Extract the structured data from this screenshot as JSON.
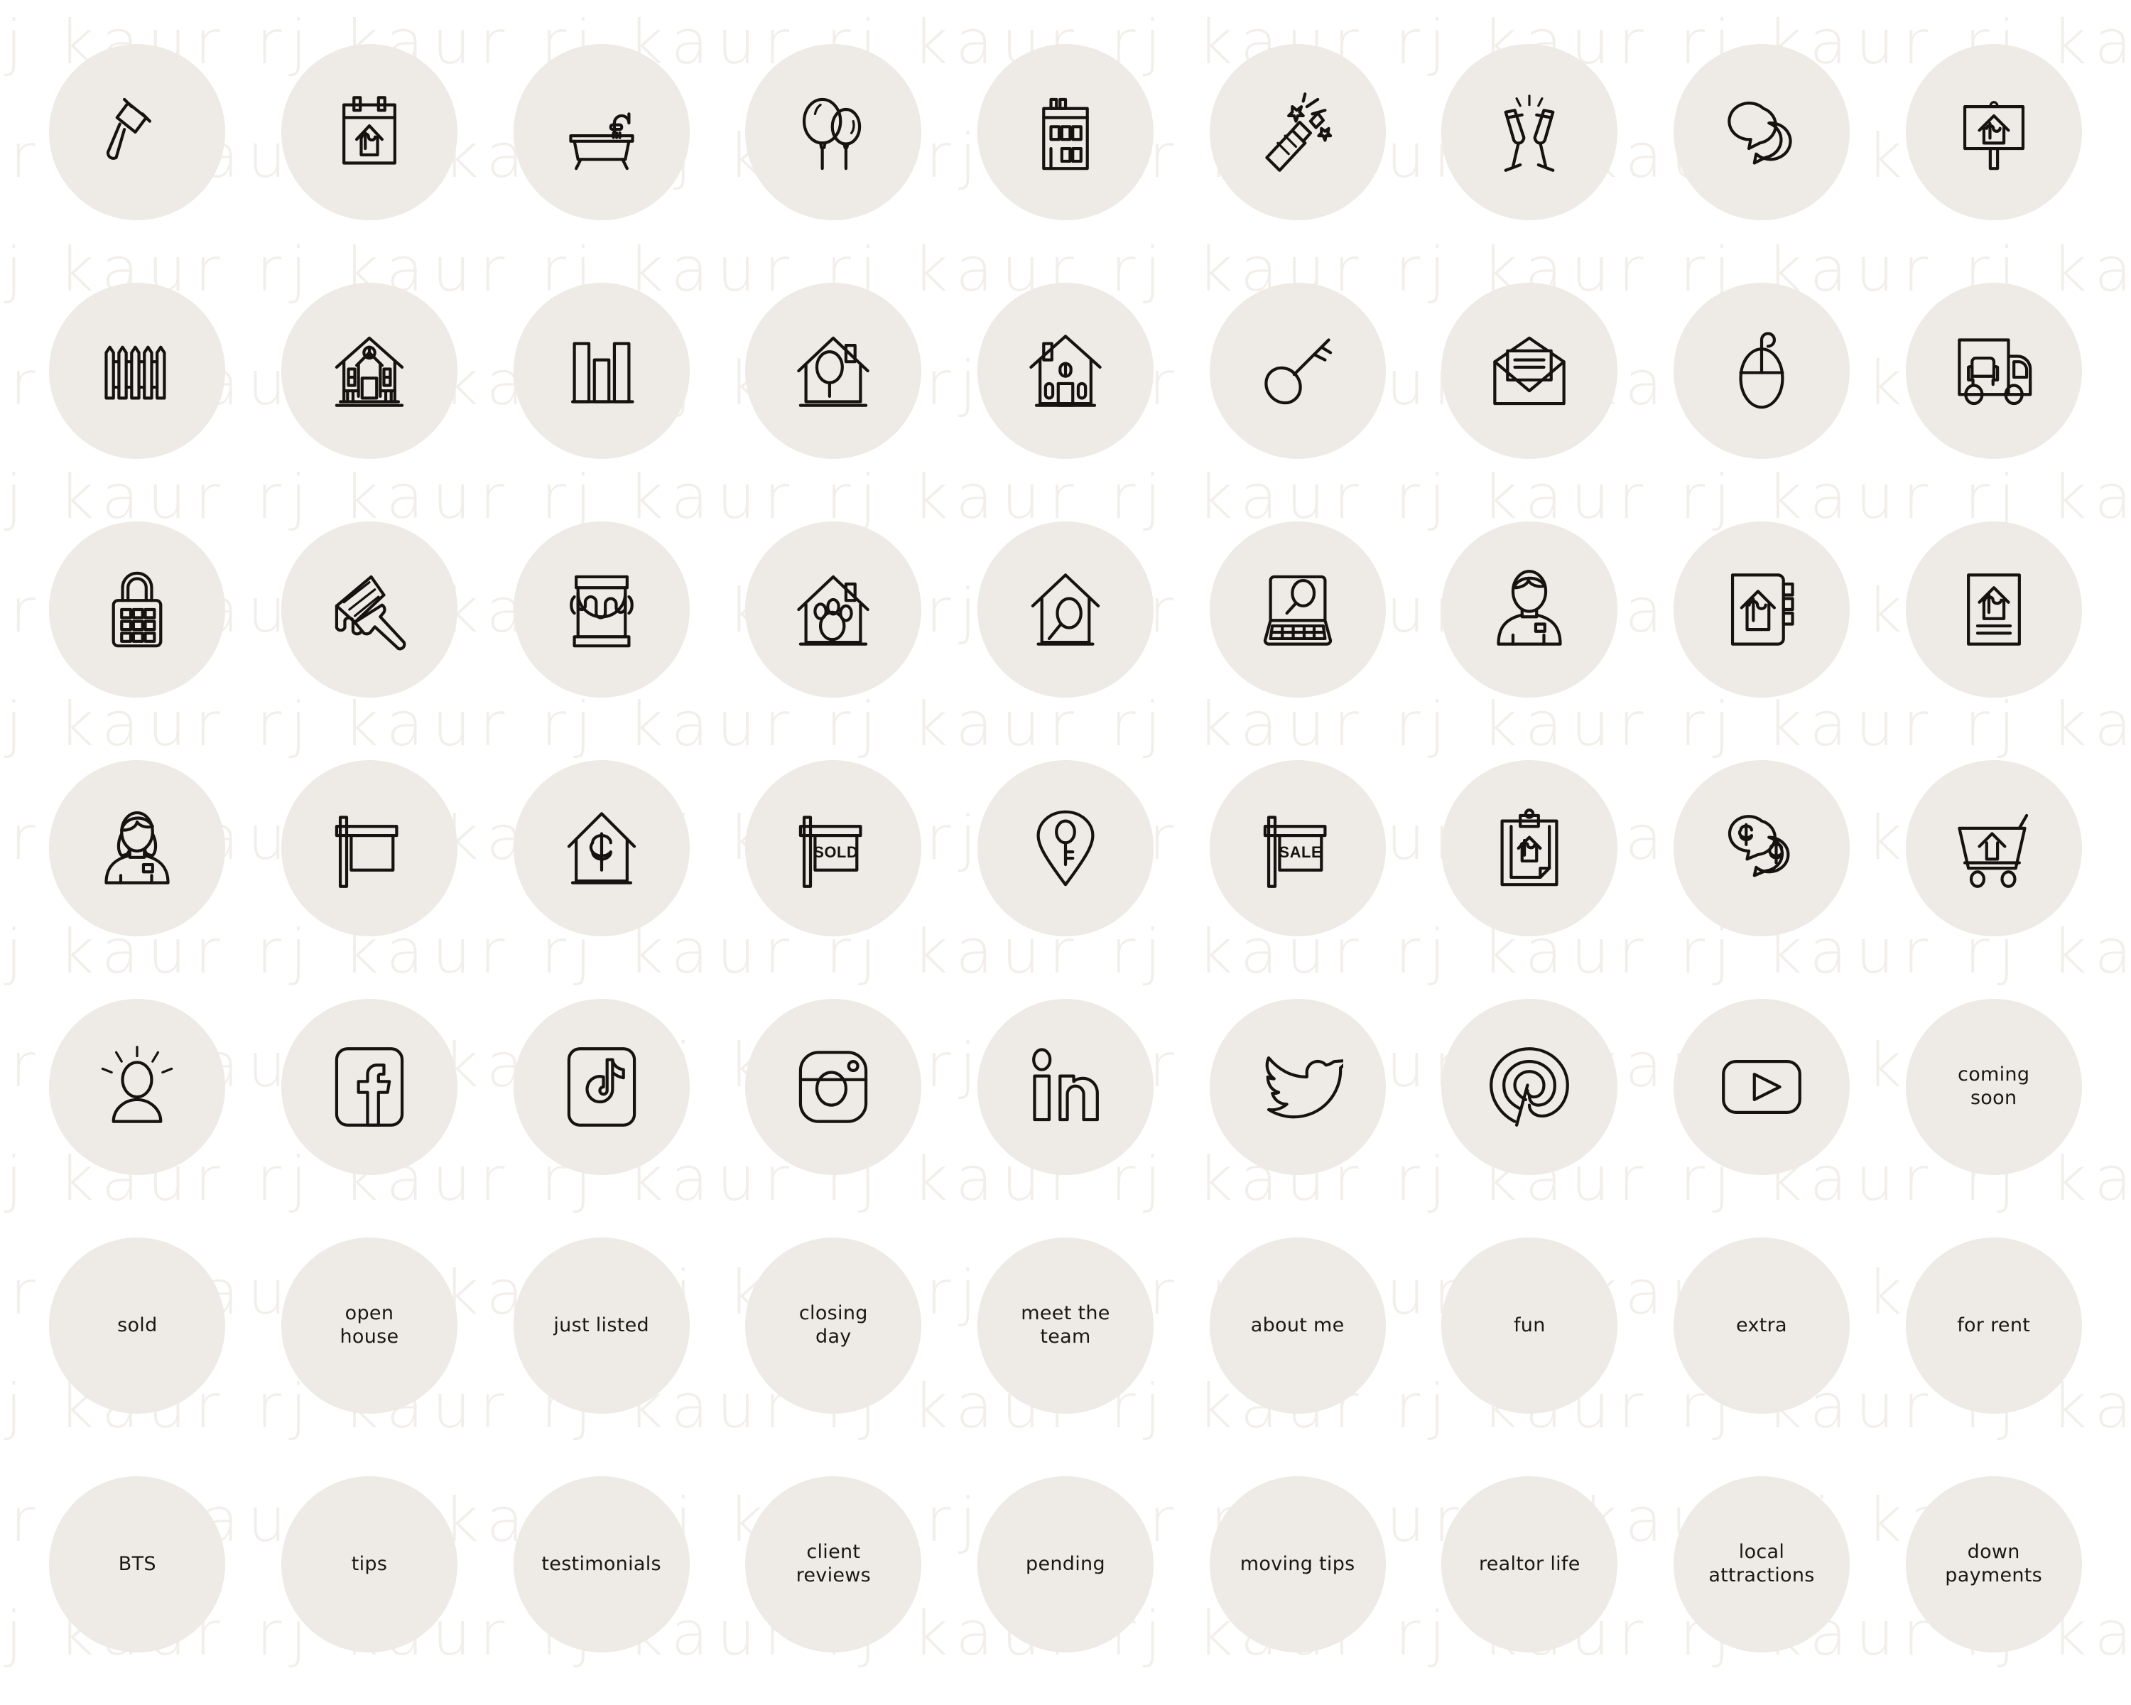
{
  "watermark": {
    "text": "rj kaur rj kaur rj kaur rj kaur rj kaur rj kaur rj kaur rj kaur",
    "color": "#f2efeb"
  },
  "theme": {
    "background": "#ffffff",
    "badge_fill": "#eeeae5",
    "stroke": "#15120f",
    "label_color": "#1b1814"
  },
  "grid": {
    "columns": 9,
    "rows": 7
  },
  "sign_labels": {
    "sold": "SOLD",
    "sale": "SALE"
  },
  "items": [
    {
      "name": "gavel-icon",
      "type": "icon",
      "label": "gavel"
    },
    {
      "name": "calendar-house-icon",
      "type": "icon",
      "label": "calendar with house price"
    },
    {
      "name": "bathtub-shower-icon",
      "type": "icon",
      "label": "bathtub with shower"
    },
    {
      "name": "balloons-icon",
      "type": "icon",
      "label": "balloons"
    },
    {
      "name": "apartment-building-icon",
      "type": "icon",
      "label": "apartment building"
    },
    {
      "name": "champagne-bottle-icon",
      "type": "icon",
      "label": "popping champagne bottle"
    },
    {
      "name": "champagne-glasses-icon",
      "type": "icon",
      "label": "clinking champagne glasses"
    },
    {
      "name": "speech-bubbles-icon",
      "type": "icon",
      "label": "speech bubbles"
    },
    {
      "name": "house-sign-post-icon",
      "type": "icon",
      "label": "house price sign on post"
    },
    {
      "name": "picket-fence-icon",
      "type": "icon",
      "label": "picket fence"
    },
    {
      "name": "farmhouse-icon",
      "type": "icon",
      "label": "farmhouse with porch"
    },
    {
      "name": "bar-chart-icon",
      "type": "icon",
      "label": "bar chart"
    },
    {
      "name": "house-search-icon",
      "type": "icon",
      "label": "house with magnifier"
    },
    {
      "name": "home-icon",
      "type": "icon",
      "label": "house with chimney"
    },
    {
      "name": "key-icon",
      "type": "icon",
      "label": "key"
    },
    {
      "name": "open-envelope-icon",
      "type": "icon",
      "label": "open envelope with letter"
    },
    {
      "name": "computer-mouse-icon",
      "type": "icon",
      "label": "computer mouse"
    },
    {
      "name": "moving-truck-icon",
      "type": "icon",
      "label": "moving truck with furniture"
    },
    {
      "name": "lockbox-icon",
      "type": "icon",
      "label": "combination lockbox"
    },
    {
      "name": "paint-brush-icon",
      "type": "icon",
      "label": "paint brush with drips"
    },
    {
      "name": "paint-can-icon",
      "type": "icon",
      "label": "paint can"
    },
    {
      "name": "pet-friendly-house-icon",
      "type": "icon",
      "label": "house with paw print"
    },
    {
      "name": "house-inspection-icon",
      "type": "icon",
      "label": "tall house with magnifier"
    },
    {
      "name": "laptop-search-icon",
      "type": "icon",
      "label": "laptop with magnifier"
    },
    {
      "name": "agent-male-icon",
      "type": "icon",
      "label": "male agent with badge"
    },
    {
      "name": "house-notebook-icon",
      "type": "icon",
      "label": "notebook with house price"
    },
    {
      "name": "house-document-icon",
      "type": "icon",
      "label": "document with house price"
    },
    {
      "name": "agent-female-icon",
      "type": "icon",
      "label": "female agent with badge"
    },
    {
      "name": "blank-yard-sign-icon",
      "type": "icon",
      "label": "blank yard sign"
    },
    {
      "name": "house-dollar-icon",
      "type": "icon",
      "label": "house with dollar sign"
    },
    {
      "name": "sold-sign-icon",
      "type": "icon",
      "label": "sold yard sign"
    },
    {
      "name": "key-location-pin-icon",
      "type": "icon",
      "label": "location pin with key"
    },
    {
      "name": "sale-sign-icon",
      "type": "icon",
      "label": "sale yard sign"
    },
    {
      "name": "clipboard-house-icon",
      "type": "icon",
      "label": "clipboard with house price"
    },
    {
      "name": "money-chat-icon",
      "type": "icon",
      "label": "dollar speech bubbles"
    },
    {
      "name": "shopping-cart-house-icon",
      "type": "icon",
      "label": "shopping cart with house"
    },
    {
      "name": "person-idea-icon",
      "type": "icon",
      "label": "person with idea"
    },
    {
      "name": "facebook-icon",
      "type": "icon",
      "label": "facebook"
    },
    {
      "name": "tiktok-icon",
      "type": "icon",
      "label": "tiktok"
    },
    {
      "name": "instagram-icon",
      "type": "icon",
      "label": "instagram"
    },
    {
      "name": "linkedin-icon",
      "type": "icon",
      "label": "linkedin"
    },
    {
      "name": "twitter-icon",
      "type": "icon",
      "label": "twitter"
    },
    {
      "name": "pinterest-icon",
      "type": "icon",
      "label": "pinterest"
    },
    {
      "name": "youtube-icon",
      "type": "icon",
      "label": "youtube"
    },
    {
      "name": "badge-coming-soon",
      "type": "text",
      "label": "coming\nsoon"
    },
    {
      "name": "badge-sold",
      "type": "text",
      "label": "sold"
    },
    {
      "name": "badge-open-house",
      "type": "text",
      "label": "open\nhouse"
    },
    {
      "name": "badge-just-listed",
      "type": "text",
      "label": "just listed"
    },
    {
      "name": "badge-closing-day",
      "type": "text",
      "label": "closing\nday"
    },
    {
      "name": "badge-meet-the-team",
      "type": "text",
      "label": "meet the\nteam"
    },
    {
      "name": "badge-about-me",
      "type": "text",
      "label": "about me"
    },
    {
      "name": "badge-fun",
      "type": "text",
      "label": "fun"
    },
    {
      "name": "badge-extra",
      "type": "text",
      "label": "extra"
    },
    {
      "name": "badge-for-rent",
      "type": "text",
      "label": "for rent"
    },
    {
      "name": "badge-bts",
      "type": "text",
      "label": "BTS"
    },
    {
      "name": "badge-tips",
      "type": "text",
      "label": "tips"
    },
    {
      "name": "badge-testimonials",
      "type": "text",
      "label": "testimonials"
    },
    {
      "name": "badge-client-reviews",
      "type": "text",
      "label": "client\nreviews"
    },
    {
      "name": "badge-pending",
      "type": "text",
      "label": "pending"
    },
    {
      "name": "badge-moving-tips",
      "type": "text",
      "label": "moving tips"
    },
    {
      "name": "badge-realtor-life",
      "type": "text",
      "label": "realtor life"
    },
    {
      "name": "badge-local-attractions",
      "type": "text",
      "label": "local\nattractions"
    },
    {
      "name": "badge-down-payments",
      "type": "text",
      "label": "down\npayments"
    }
  ]
}
